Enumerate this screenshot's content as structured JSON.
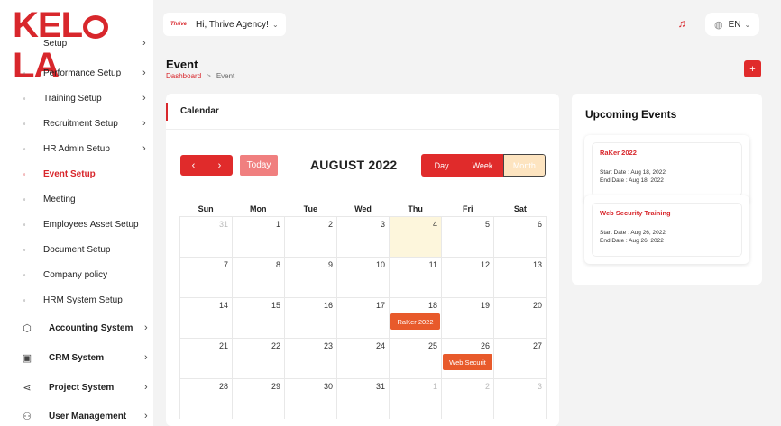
{
  "brand": {
    "logo_text": "KELOLA",
    "accent": "#d8272c"
  },
  "sidebar": {
    "items": [
      {
        "label": "Setup",
        "chevron": true
      },
      {
        "label": "Performance Setup",
        "chevron": true
      },
      {
        "label": "Training Setup",
        "chevron": true
      },
      {
        "label": "Recruitment Setup",
        "chevron": true
      },
      {
        "label": "HR Admin Setup",
        "chevron": true
      },
      {
        "label": "Event Setup",
        "chevron": false,
        "active": true
      },
      {
        "label": "Meeting",
        "chevron": false
      },
      {
        "label": "Employees Asset Setup",
        "chevron": false
      },
      {
        "label": "Document Setup",
        "chevron": false
      },
      {
        "label": "Company policy",
        "chevron": false
      },
      {
        "label": "HRM System Setup",
        "chevron": false
      }
    ],
    "systems": [
      {
        "label": "Accounting System",
        "icon": "box-icon"
      },
      {
        "label": "CRM System",
        "icon": "layers-icon"
      },
      {
        "label": "Project System",
        "icon": "share-icon"
      },
      {
        "label": "User Management",
        "icon": "users-icon"
      }
    ]
  },
  "topbar": {
    "avatar_text": "Thrive",
    "greeting": "Hi, Thrive Agency!",
    "language": "EN"
  },
  "page": {
    "title": "Event",
    "breadcrumb": [
      "Dashboard",
      "Event"
    ],
    "add_label": "+"
  },
  "calendar": {
    "card_title": "Calendar",
    "prev": "‹",
    "next": "›",
    "today_label": "Today",
    "month_label": "AUGUST 2022",
    "views": [
      "Day",
      "Week",
      "Month"
    ],
    "selected_view": "Month",
    "weekdays": [
      "Sun",
      "Mon",
      "Tue",
      "Wed",
      "Thu",
      "Fri",
      "Sat"
    ],
    "weeks": [
      [
        {
          "d": "31",
          "muted": true
        },
        {
          "d": "1"
        },
        {
          "d": "2"
        },
        {
          "d": "3"
        },
        {
          "d": "4",
          "today": true
        },
        {
          "d": "5"
        },
        {
          "d": "6"
        }
      ],
      [
        {
          "d": "7"
        },
        {
          "d": "8"
        },
        {
          "d": "9"
        },
        {
          "d": "10"
        },
        {
          "d": "11"
        },
        {
          "d": "12"
        },
        {
          "d": "13"
        }
      ],
      [
        {
          "d": "14"
        },
        {
          "d": "15"
        },
        {
          "d": "16"
        },
        {
          "d": "17"
        },
        {
          "d": "18",
          "event": "RaKer 2022"
        },
        {
          "d": "19"
        },
        {
          "d": "20"
        }
      ],
      [
        {
          "d": "21"
        },
        {
          "d": "22"
        },
        {
          "d": "23"
        },
        {
          "d": "24"
        },
        {
          "d": "25"
        },
        {
          "d": "26",
          "event": "Web Securit"
        },
        {
          "d": "27"
        }
      ],
      [
        {
          "d": "28"
        },
        {
          "d": "29"
        },
        {
          "d": "30"
        },
        {
          "d": "31"
        },
        {
          "d": "1",
          "muted": true
        },
        {
          "d": "2",
          "muted": true
        },
        {
          "d": "3",
          "muted": true
        }
      ]
    ]
  },
  "upcoming": {
    "title": "Upcoming Events",
    "events": [
      {
        "name": "RaKer 2022",
        "start": "Start Date : Aug 18, 2022",
        "end": "End Date : Aug 18, 2022"
      },
      {
        "name": "Web Security Training",
        "start": "Start Date : Aug 26, 2022",
        "end": "End Date : Aug 26, 2022"
      }
    ]
  }
}
